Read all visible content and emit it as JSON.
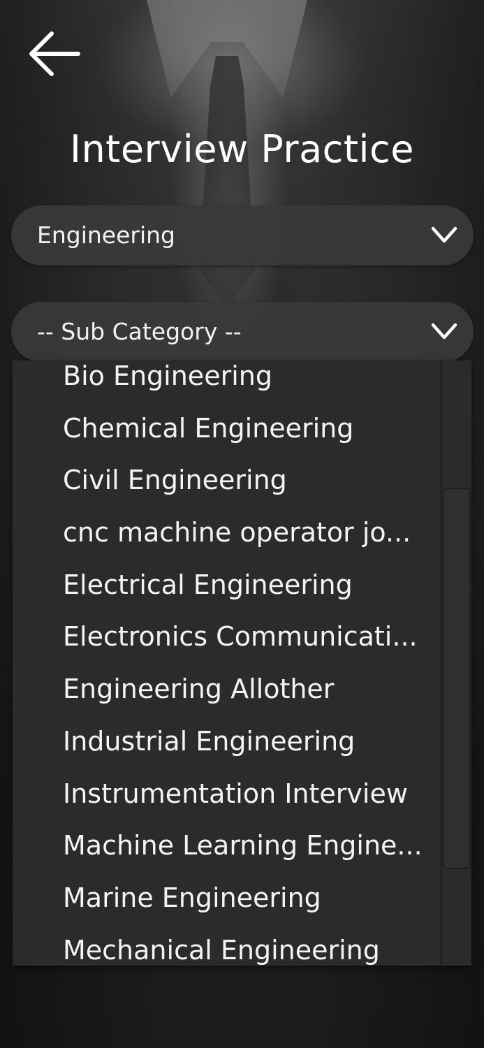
{
  "header": {
    "title": "Interview Practice",
    "back_icon": "arrow-left-icon"
  },
  "category_select": {
    "value": "Engineering",
    "icon": "chevron-down-icon"
  },
  "sub_category_select": {
    "value": "-- Sub Category --",
    "icon": "chevron-down-icon"
  },
  "dropdown": {
    "items": [
      "Bio Engineering",
      "Chemical Engineering",
      "Civil Engineering",
      "cnc machine operator jo...",
      "Electrical Engineering",
      "Electronics Communicati...",
      "Engineering Allother",
      "Industrial Engineering",
      "Instrumentation Interview",
      "Machine Learning Engine...",
      "Marine Engineering",
      "Mechanical Engineering"
    ]
  },
  "colors": {
    "text": "#ffffff",
    "select_bg": "#3a3a3a",
    "dropdown_bg": "#2b2b2b"
  }
}
